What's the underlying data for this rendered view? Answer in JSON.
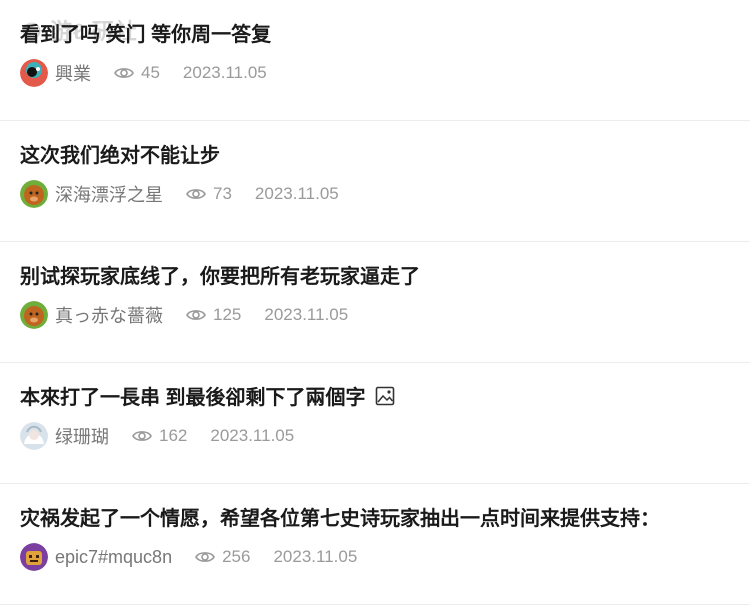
{
  "watermark": "❍ 游ℓ 研社",
  "posts": [
    {
      "title": "看到了吗 笑门 等你周一答复",
      "author": "興業",
      "views": "45",
      "date": "2023.11.05",
      "has_image": false
    },
    {
      "title": "这次我们绝对不能让步",
      "author": "深海漂浮之星",
      "views": "73",
      "date": "2023.11.05",
      "has_image": false
    },
    {
      "title": "别试探玩家底线了，你要把所有老玩家逼走了",
      "author": "真っ赤な薔薇",
      "views": "125",
      "date": "2023.11.05",
      "has_image": false
    },
    {
      "title": "本來打了一長串 到最後卻剩下了兩個字",
      "author": "绿珊瑚",
      "views": "162",
      "date": "2023.11.05",
      "has_image": true
    },
    {
      "title": "灾祸发起了一个情愿，希望各位第七史诗玩家抽出一点时间来提供支持：",
      "author": "epic7#mquc8n",
      "views": "256",
      "date": "2023.11.05",
      "has_image": false
    }
  ]
}
